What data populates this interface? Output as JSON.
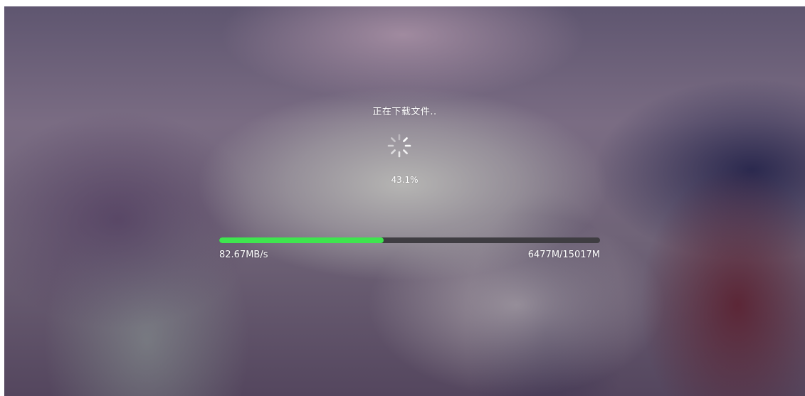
{
  "download": {
    "status_text": "正在下载文件..",
    "percent_text": "43.1%",
    "progress_fraction": 0.431,
    "speed_text": "82.67MB/s",
    "size_text": "6477M/15017M"
  },
  "icons": {
    "spinner": "loading-spinner-icon"
  },
  "colors": {
    "progress_fill": "#3fe54f",
    "progress_track": "#3f3d42",
    "text": "#ffffff"
  }
}
